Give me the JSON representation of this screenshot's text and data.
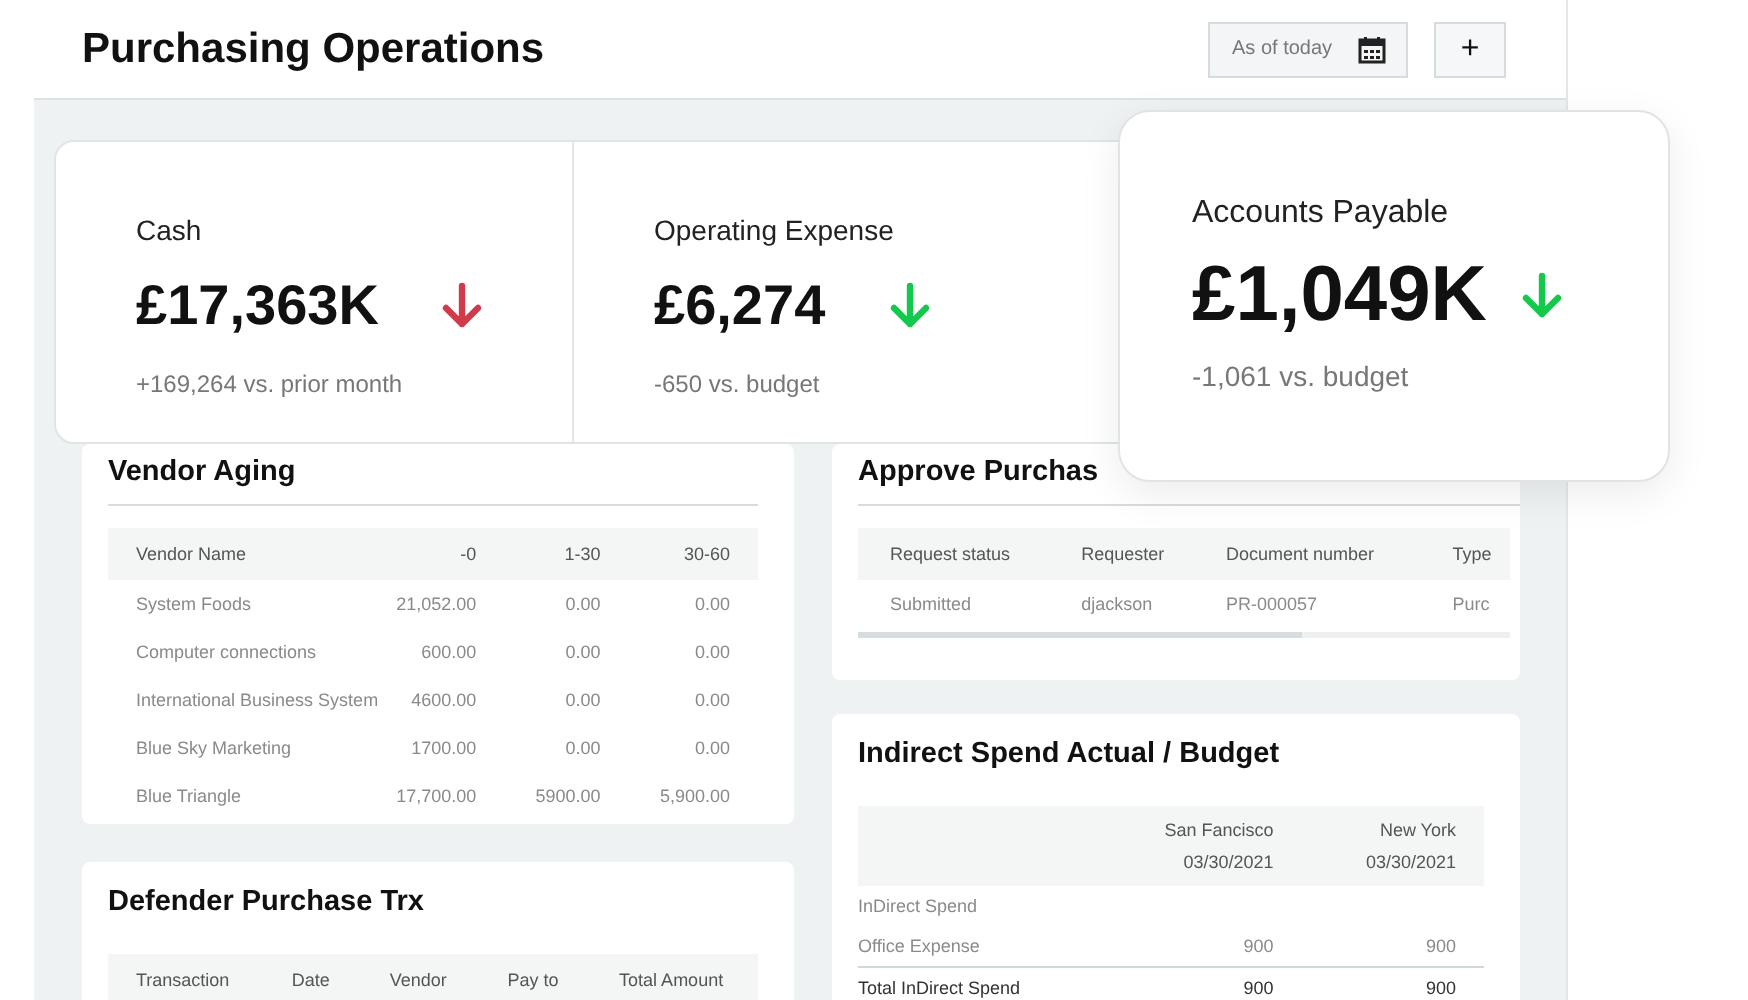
{
  "header": {
    "title": "Purchasing Operations",
    "date_filter": {
      "placeholder": "As of today"
    },
    "add_button": "+"
  },
  "kpis": [
    {
      "label": "Cash",
      "value": "£17,363K",
      "color": "#d13a4a",
      "comparison": "+169,264 vs. prior month"
    },
    {
      "label": "Operating Expense",
      "value": "£6,274",
      "color": "#13c94b",
      "comparison": "-650 vs. budget"
    }
  ],
  "featured_kpi": {
    "label": "Accounts Payable",
    "value": "£1,049K",
    "color": "#13c94b",
    "comparison": "-1,061 vs. budget"
  },
  "vendor_aging": {
    "title": "Vendor Aging",
    "columns": [
      "Vendor Name",
      "-0",
      "1-30",
      "30-60"
    ],
    "rows": [
      [
        "System Foods",
        "21,052.00",
        "0.00",
        "0.00"
      ],
      [
        "Computer connections",
        "600.00",
        "0.00",
        "0.00"
      ],
      [
        "International Business System",
        "4600.00",
        "0.00",
        "0.00"
      ],
      [
        "Blue Sky Marketing",
        "1700.00",
        "0.00",
        "0.00"
      ],
      [
        "Blue Triangle",
        "17,700.00",
        "5900.00",
        "5,900.00"
      ]
    ]
  },
  "defender": {
    "title": "Defender Purchase Trx",
    "columns": [
      "Transaction",
      "Date",
      "Vendor",
      "Pay to",
      "Total Amount"
    ]
  },
  "approve": {
    "title": "Approve Purchas",
    "columns": [
      "Request status",
      "Requester",
      "Document number",
      "Type"
    ],
    "rows": [
      [
        "Submitted",
        "djackson",
        "PR-000057",
        "Purc"
      ]
    ]
  },
  "indirect": {
    "title": "Indirect Spend Actual / Budget",
    "columns": [
      {
        "label": "San Fancisco",
        "date": "03/30/2021"
      },
      {
        "label": "New York",
        "date": "03/30/2021"
      }
    ],
    "rows": [
      {
        "label": "InDirect Spend",
        "values": [],
        "children": [
          {
            "label": "Office Expense",
            "values": [
              "900",
              "900"
            ]
          }
        ]
      },
      {
        "label": "Total InDirect Spend",
        "values": [
          "900",
          "900"
        ],
        "kind": "total"
      }
    ]
  }
}
